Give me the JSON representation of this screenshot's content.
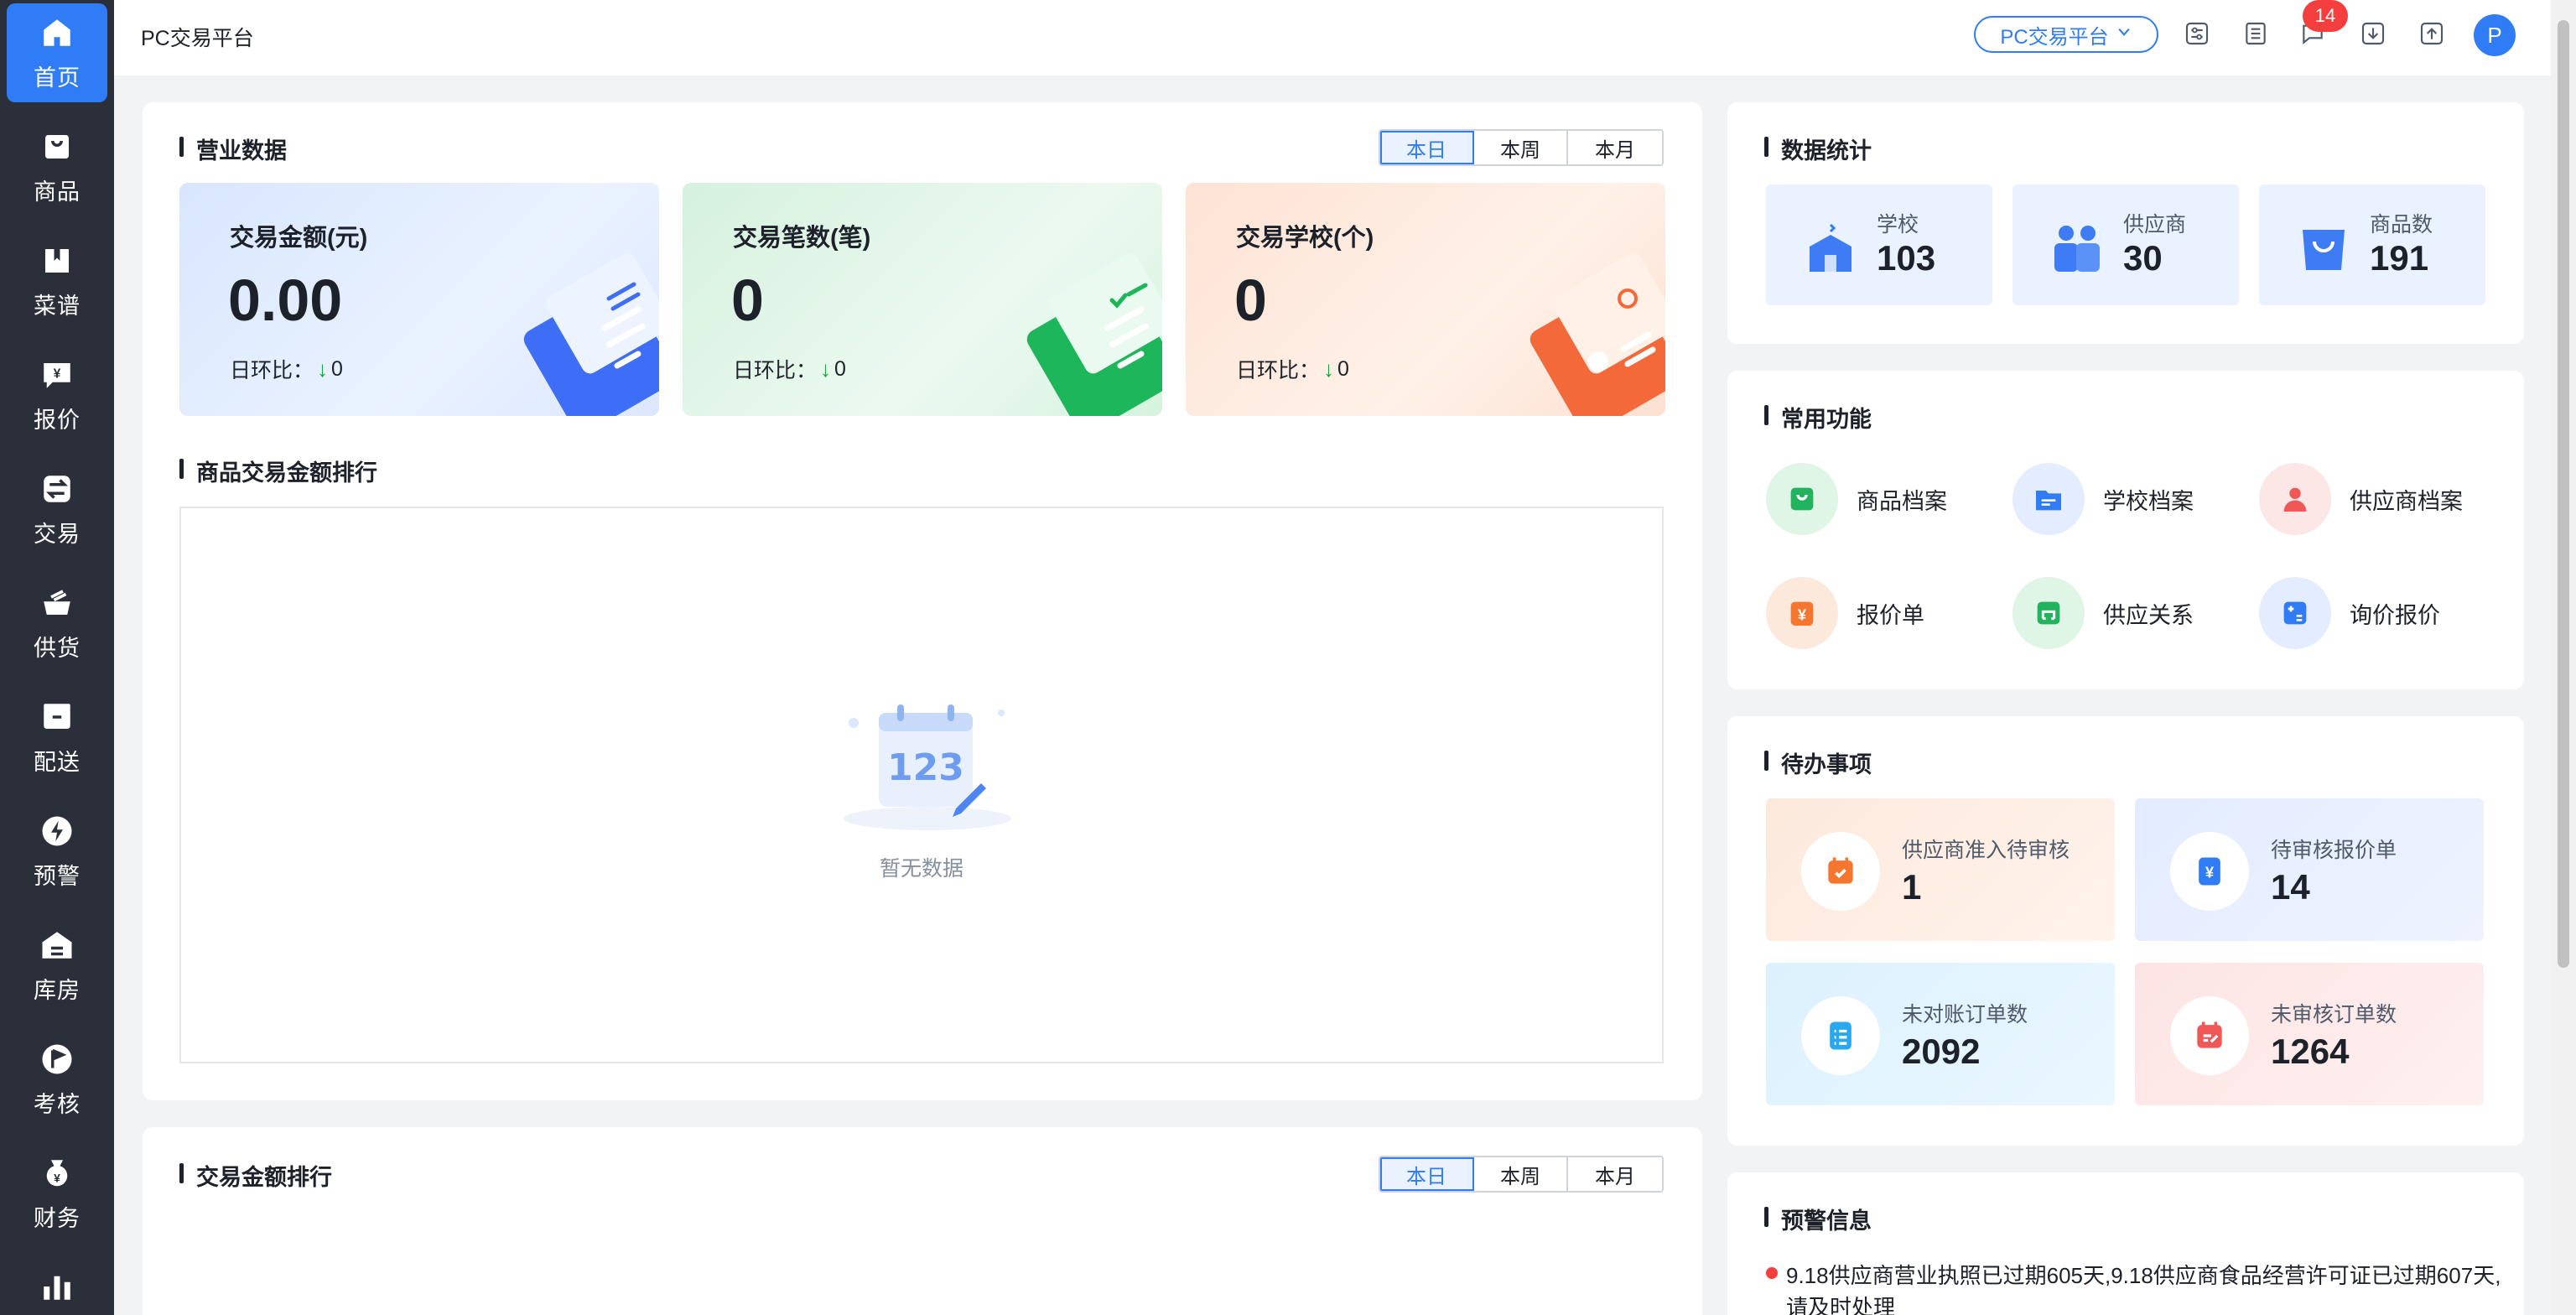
{
  "sidebar": {
    "items": [
      {
        "label": "首页",
        "icon": "home-icon"
      },
      {
        "label": "商品",
        "icon": "bag-icon"
      },
      {
        "label": "菜谱",
        "icon": "recipe-icon"
      },
      {
        "label": "报价",
        "icon": "quote-icon"
      },
      {
        "label": "交易",
        "icon": "exchange-icon"
      },
      {
        "label": "供货",
        "icon": "supply-icon"
      },
      {
        "label": "配送",
        "icon": "delivery-icon"
      },
      {
        "label": "预警",
        "icon": "bolt-icon"
      },
      {
        "label": "库房",
        "icon": "warehouse-icon"
      },
      {
        "label": "考核",
        "icon": "flag-icon"
      },
      {
        "label": "财务",
        "icon": "money-bag-icon"
      },
      {
        "label": "",
        "icon": "bar-chart-icon"
      }
    ]
  },
  "header": {
    "title": "PC交易平台",
    "platform_select": "PC交易平台",
    "notification_count": "14",
    "avatar_letter": "P"
  },
  "business": {
    "title": "营业数据",
    "periods": [
      "本日",
      "本周",
      "本月"
    ],
    "cards": [
      {
        "label": "交易金额(元)",
        "value": "0.00",
        "compare_label": "日环比：",
        "compare_value": "0"
      },
      {
        "label": "交易笔数(笔)",
        "value": "0",
        "compare_label": "日环比：",
        "compare_value": "0"
      },
      {
        "label": "交易学校(个)",
        "value": "0",
        "compare_label": "日环比：",
        "compare_value": "0"
      }
    ]
  },
  "ranking": {
    "title": "商品交易金额排行",
    "empty_text": "暂无数据"
  },
  "amount_ranking": {
    "title": "交易金额排行",
    "periods": [
      "本日",
      "本周",
      "本月"
    ]
  },
  "stats": {
    "title": "数据统计",
    "items": [
      {
        "label": "学校",
        "value": "103"
      },
      {
        "label": "供应商",
        "value": "30"
      },
      {
        "label": "商品数",
        "value": "191"
      }
    ]
  },
  "functions": {
    "title": "常用功能",
    "items": [
      {
        "label": "商品档案",
        "color": "#22b35e"
      },
      {
        "label": "学校档案",
        "color": "#2f7cf6"
      },
      {
        "label": "供应商档案",
        "color": "#f05858"
      },
      {
        "label": "报价单",
        "color": "#f5772f"
      },
      {
        "label": "供应关系",
        "color": "#22b35e"
      },
      {
        "label": "询价报价",
        "color": "#2f7cf6"
      }
    ]
  },
  "todos": {
    "title": "待办事项",
    "items": [
      {
        "label": "供应商准入待审核",
        "value": "1"
      },
      {
        "label": "待审核报价单",
        "value": "14"
      },
      {
        "label": "未对账订单数",
        "value": "2092"
      },
      {
        "label": "未审核订单数",
        "value": "1264"
      }
    ]
  },
  "warnings": {
    "title": "预警信息",
    "items": [
      "9.18供应商营业执照已过期605天,9.18供应商食品经营许可证已过期607天,请及时处理"
    ]
  }
}
